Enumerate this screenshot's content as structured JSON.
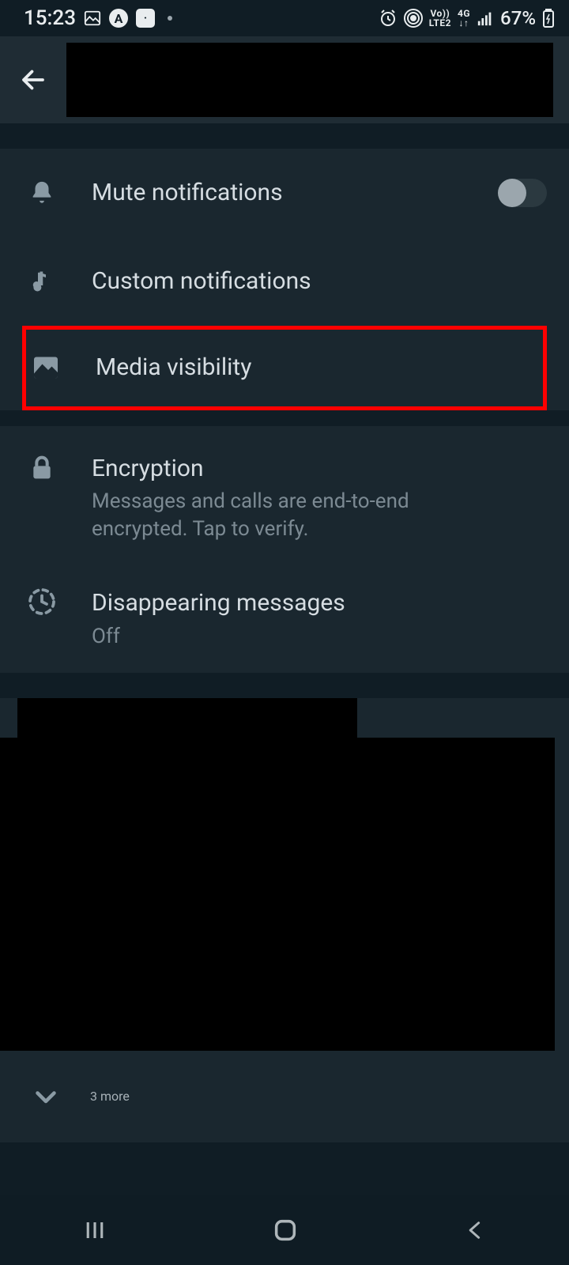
{
  "status": {
    "time": "15:23",
    "battery": "67%",
    "network1": "Vo))",
    "network2": "LTE2",
    "network3": "4G"
  },
  "settings": {
    "mute": {
      "label": "Mute notifications"
    },
    "custom": {
      "label": "Custom notifications"
    },
    "media": {
      "label": "Media visibility"
    },
    "encryption": {
      "label": "Encryption",
      "desc": "Messages and calls are end-to-end encrypted. Tap to verify."
    },
    "disappearing": {
      "label": "Disappearing messages",
      "value": "Off"
    }
  },
  "members": {
    "more": "3 more"
  }
}
